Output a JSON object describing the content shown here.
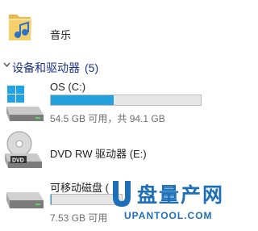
{
  "music": {
    "label": "音乐",
    "icon": "music-folder-icon"
  },
  "section": {
    "title": "设备和驱动器",
    "count": "(5)"
  },
  "drives": [
    {
      "label": "OS (C:)",
      "icon": "windows-drive-icon",
      "usage_fraction": 0.42,
      "detail": "54.5 GB 可用，共 94.1 GB"
    },
    {
      "label": "DVD RW 驱动器 (E:)",
      "icon": "dvd-drive-icon"
    },
    {
      "label": "可移动磁盘 (",
      "icon": "removable-disk-icon",
      "usage_fraction": 0.01,
      "detail": "7.53 GB 可用"
    }
  ],
  "watermark": {
    "logo": "u-logo",
    "title": "盘量产网",
    "domain": "UPANTOOL.COM"
  },
  "colors": {
    "accent": "#26a0da",
    "section_title": "#1e3287",
    "watermark": "#1d6fb8"
  }
}
